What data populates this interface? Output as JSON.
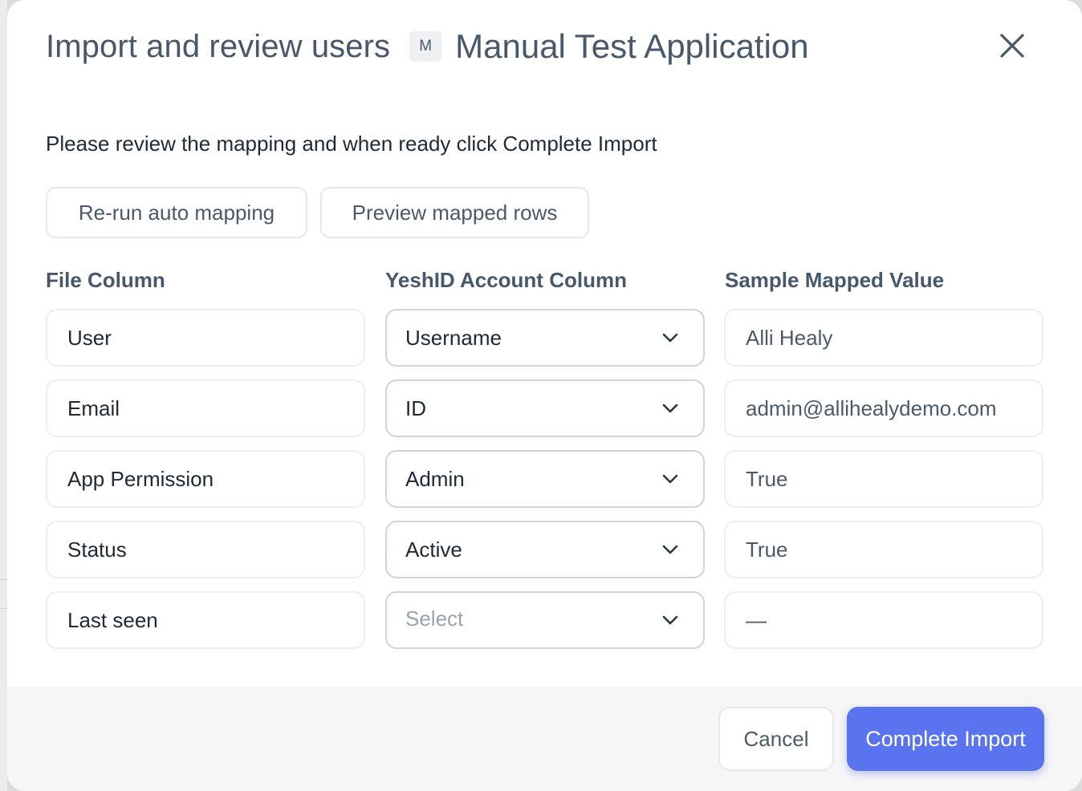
{
  "header": {
    "title": "Import and review users",
    "app_badge": "M",
    "app_name": "Manual Test Application"
  },
  "instructions": "Please review the mapping and when ready click Complete Import",
  "actions": {
    "rerun_label": "Re-run auto mapping",
    "preview_label": "Preview mapped rows"
  },
  "columns": {
    "file": "File Column",
    "account": "YeshID Account Column",
    "sample": "Sample Mapped Value"
  },
  "rows": [
    {
      "file": "User",
      "account": "Username",
      "sample": "Alli Healy"
    },
    {
      "file": "Email",
      "account": "ID",
      "sample": "admin@allihealydemo.com"
    },
    {
      "file": "App Permission",
      "account": "Admin",
      "sample": "True"
    },
    {
      "file": "Status",
      "account": "Active",
      "sample": "True"
    },
    {
      "file": "Last seen",
      "account": "Select",
      "sample": "—"
    }
  ],
  "footer": {
    "cancel_label": "Cancel",
    "complete_label": "Complete Import"
  },
  "colors": {
    "primary": "#5a73ef",
    "heading": "#46586a",
    "text": "#1f2a36",
    "placeholder": "#9aa3ad"
  },
  "icons": {
    "close": "close-icon",
    "dropdown": "chevron-down-icon"
  }
}
